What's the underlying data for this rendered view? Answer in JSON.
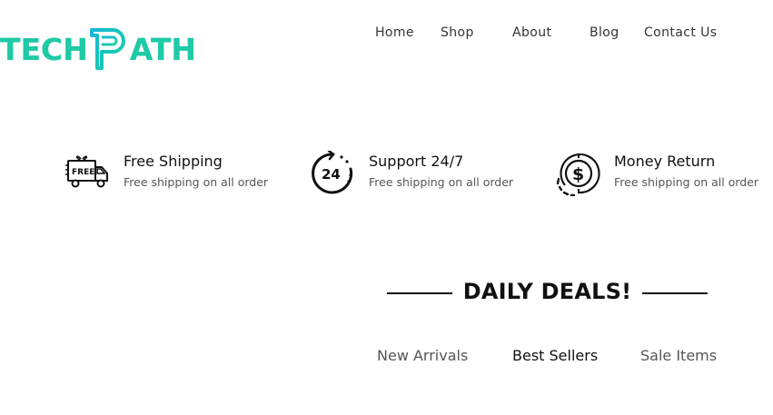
{
  "header": {
    "logo": {
      "prefix": "TECH",
      "suffix": "ATH"
    },
    "nav": [
      {
        "label": "Home"
      },
      {
        "label": "Shop"
      },
      {
        "label": "About"
      },
      {
        "label": "Blog"
      },
      {
        "label": "Contact Us"
      }
    ]
  },
  "features": [
    {
      "icon": "free-delivery-truck-icon",
      "title": "Free Shipping",
      "subtitle": "Free shipping on all order"
    },
    {
      "icon": "support-24-7-icon",
      "title": "Support 24/7",
      "subtitle": "Free shipping on all order"
    },
    {
      "icon": "money-return-icon",
      "title": "Money Return",
      "subtitle": "Free shipping on all order"
    }
  ],
  "deals": {
    "title": "DAILY DEALS!",
    "tabs": [
      {
        "label": "New Arrivals",
        "active": false
      },
      {
        "label": "Best Sellers",
        "active": true
      },
      {
        "label": "Sale Items",
        "active": false
      }
    ]
  },
  "colors": {
    "brand_gradient_start": "#1bd3a0",
    "brand_gradient_end": "#16bcc4",
    "text_primary": "#111111",
    "text_secondary": "#555555"
  }
}
